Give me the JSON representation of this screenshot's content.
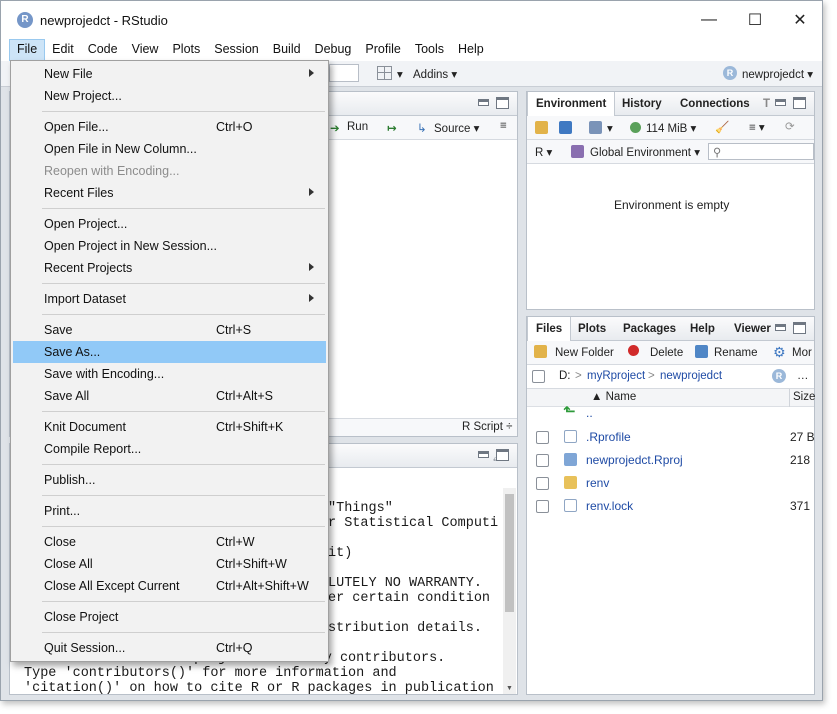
{
  "window": {
    "title": "newprojedct - RStudio",
    "app_icon": "R",
    "controls": {
      "minimize": "—",
      "maximize": "☐",
      "close": "✕"
    }
  },
  "menubar": [
    "File",
    "Edit",
    "Code",
    "View",
    "Plots",
    "Session",
    "Build",
    "Debug",
    "Profile",
    "Tools",
    "Help"
  ],
  "toolbar": {
    "addins": "Addins ▾",
    "project": "newprojedct ▾",
    "project_icon": "R"
  },
  "editor": {
    "run": "Run",
    "source": "Source ▾",
    "script_type": "R Script ÷"
  },
  "console": {
    "lines": [
      "\"Things\"",
      "r Statistical Computi",
      "",
      "it)",
      "",
      "LUTELY NO WARRANTY.",
      "er certain condition",
      "",
      "stribution details.",
      "",
      "R is a collaborative project with many contributors.",
      "Type 'contributors()' for more information and",
      "'citation()' on how to cite R or R packages in publication"
    ]
  },
  "environment": {
    "tabs": [
      "Environment",
      "History",
      "Connections",
      "T"
    ],
    "memory": "114 MiB ▾",
    "lang": "R ▾",
    "scope": "Global Environment ▾",
    "empty": "Environment is empty"
  },
  "files": {
    "tabs": [
      "Files",
      "Plots",
      "Packages",
      "Help",
      "Viewer"
    ],
    "actions": {
      "new_folder": "New Folder",
      "delete": "Delete",
      "rename": "Rename",
      "more": "Mor"
    },
    "path": [
      "D:",
      "myRproject",
      "newprojedct"
    ],
    "path_sep": ">",
    "columns": {
      "name": "▲ Name",
      "size": "Size"
    },
    "up": "..",
    "rows": [
      {
        "name": ".Rprofile",
        "size": "27 B"
      },
      {
        "name": "newprojedct.Rproj",
        "size": "218"
      },
      {
        "name": "renv",
        "size": ""
      },
      {
        "name": "renv.lock",
        "size": "371"
      }
    ]
  },
  "file_menu": {
    "groups": [
      [
        {
          "label": "New File",
          "shortcut": "",
          "submenu": true,
          "disabled": false,
          "highlighted": false
        },
        {
          "label": "New Project...",
          "shortcut": "",
          "submenu": false,
          "disabled": false,
          "highlighted": false
        }
      ],
      [
        {
          "label": "Open File...",
          "shortcut": "Ctrl+O",
          "submenu": false,
          "disabled": false,
          "highlighted": false
        },
        {
          "label": "Open File in New Column...",
          "shortcut": "",
          "submenu": false,
          "disabled": false,
          "highlighted": false
        },
        {
          "label": "Reopen with Encoding...",
          "shortcut": "",
          "submenu": false,
          "disabled": true,
          "highlighted": false
        },
        {
          "label": "Recent Files",
          "shortcut": "",
          "submenu": true,
          "disabled": false,
          "highlighted": false
        }
      ],
      [
        {
          "label": "Open Project...",
          "shortcut": "",
          "submenu": false,
          "disabled": false,
          "highlighted": false
        },
        {
          "label": "Open Project in New Session...",
          "shortcut": "",
          "submenu": false,
          "disabled": false,
          "highlighted": false
        },
        {
          "label": "Recent Projects",
          "shortcut": "",
          "submenu": true,
          "disabled": false,
          "highlighted": false
        }
      ],
      [
        {
          "label": "Import Dataset",
          "shortcut": "",
          "submenu": true,
          "disabled": false,
          "highlighted": false
        }
      ],
      [
        {
          "label": "Save",
          "shortcut": "Ctrl+S",
          "submenu": false,
          "disabled": false,
          "highlighted": false
        },
        {
          "label": "Save As...",
          "shortcut": "",
          "submenu": false,
          "disabled": false,
          "highlighted": true
        },
        {
          "label": "Save with Encoding...",
          "shortcut": "",
          "submenu": false,
          "disabled": false,
          "highlighted": false
        },
        {
          "label": "Save All",
          "shortcut": "Ctrl+Alt+S",
          "submenu": false,
          "disabled": false,
          "highlighted": false
        }
      ],
      [
        {
          "label": "Knit Document",
          "shortcut": "Ctrl+Shift+K",
          "submenu": false,
          "disabled": false,
          "highlighted": false
        },
        {
          "label": "Compile Report...",
          "shortcut": "",
          "submenu": false,
          "disabled": false,
          "highlighted": false
        }
      ],
      [
        {
          "label": "Publish...",
          "shortcut": "",
          "submenu": false,
          "disabled": false,
          "highlighted": false
        }
      ],
      [
        {
          "label": "Print...",
          "shortcut": "",
          "submenu": false,
          "disabled": false,
          "highlighted": false
        }
      ],
      [
        {
          "label": "Close",
          "shortcut": "Ctrl+W",
          "submenu": false,
          "disabled": false,
          "highlighted": false
        },
        {
          "label": "Close All",
          "shortcut": "Ctrl+Shift+W",
          "submenu": false,
          "disabled": false,
          "highlighted": false
        },
        {
          "label": "Close All Except Current",
          "shortcut": "Ctrl+Alt+Shift+W",
          "submenu": false,
          "disabled": false,
          "highlighted": false
        }
      ],
      [
        {
          "label": "Close Project",
          "shortcut": "",
          "submenu": false,
          "disabled": false,
          "highlighted": false
        }
      ],
      [
        {
          "label": "Quit Session...",
          "shortcut": "Ctrl+Q",
          "submenu": false,
          "disabled": false,
          "highlighted": false
        }
      ]
    ]
  },
  "colors": {
    "highlight": "#91c9f7",
    "link": "#1f4ba5",
    "menu_bg": "#f2f2f2",
    "disabled_text": "#8c8c8c"
  }
}
